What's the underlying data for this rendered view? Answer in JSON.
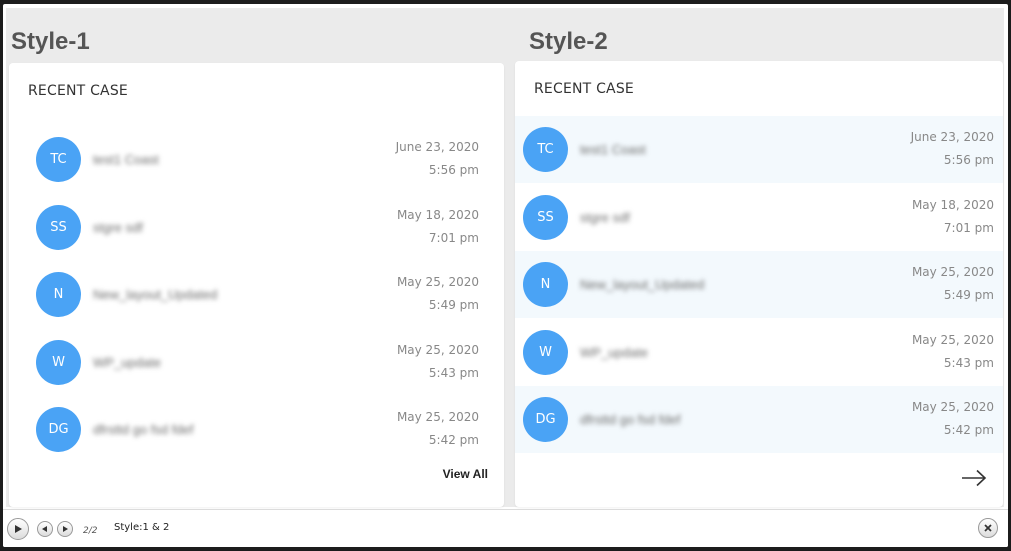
{
  "styles": [
    {
      "title": "Style-1",
      "header": "RECENT CASE",
      "footer_link": "View All",
      "cases": [
        {
          "initials": "TC",
          "title": "test1 Coast",
          "date": "June 23, 2020",
          "time": "5:56 pm"
        },
        {
          "initials": "SS",
          "title": "stgre sdf",
          "date": "May 18, 2020",
          "time": "7:01 pm"
        },
        {
          "initials": "N",
          "title": "New_layout_Updated",
          "date": "May 25, 2020",
          "time": "5:49 pm"
        },
        {
          "initials": "W",
          "title": "WP_update",
          "date": "May 25, 2020",
          "time": "5:43 pm"
        },
        {
          "initials": "DG",
          "title": "dfrsttd go fsd fdef",
          "date": "May 25, 2020",
          "time": "5:42 pm"
        }
      ]
    },
    {
      "title": "Style-2",
      "header": "RECENT CASE",
      "footer_icon": "arrow-right-icon",
      "cases": [
        {
          "initials": "TC",
          "title": "test1 Coast",
          "date": "June 23, 2020",
          "time": "5:56 pm"
        },
        {
          "initials": "SS",
          "title": "stgre sdf",
          "date": "May 18, 2020",
          "time": "7:01 pm"
        },
        {
          "initials": "N",
          "title": "New_layout_Updated",
          "date": "May 25, 2020",
          "time": "5:49 pm"
        },
        {
          "initials": "W",
          "title": "WP_update",
          "date": "May 25, 2020",
          "time": "5:43 pm"
        },
        {
          "initials": "DG",
          "title": "dfrsttd go fsd fdef",
          "date": "May 25, 2020",
          "time": "5:42 pm"
        }
      ]
    }
  ],
  "colors": {
    "avatar": "#4aa3f5",
    "row_alt": "#f3f9fd",
    "panel_bg": "#ebebeb"
  },
  "player": {
    "counter": "2/2",
    "label": "Style:1 & 2",
    "icons": [
      "play-icon",
      "previous-icon",
      "next-icon",
      "close-icon"
    ]
  }
}
